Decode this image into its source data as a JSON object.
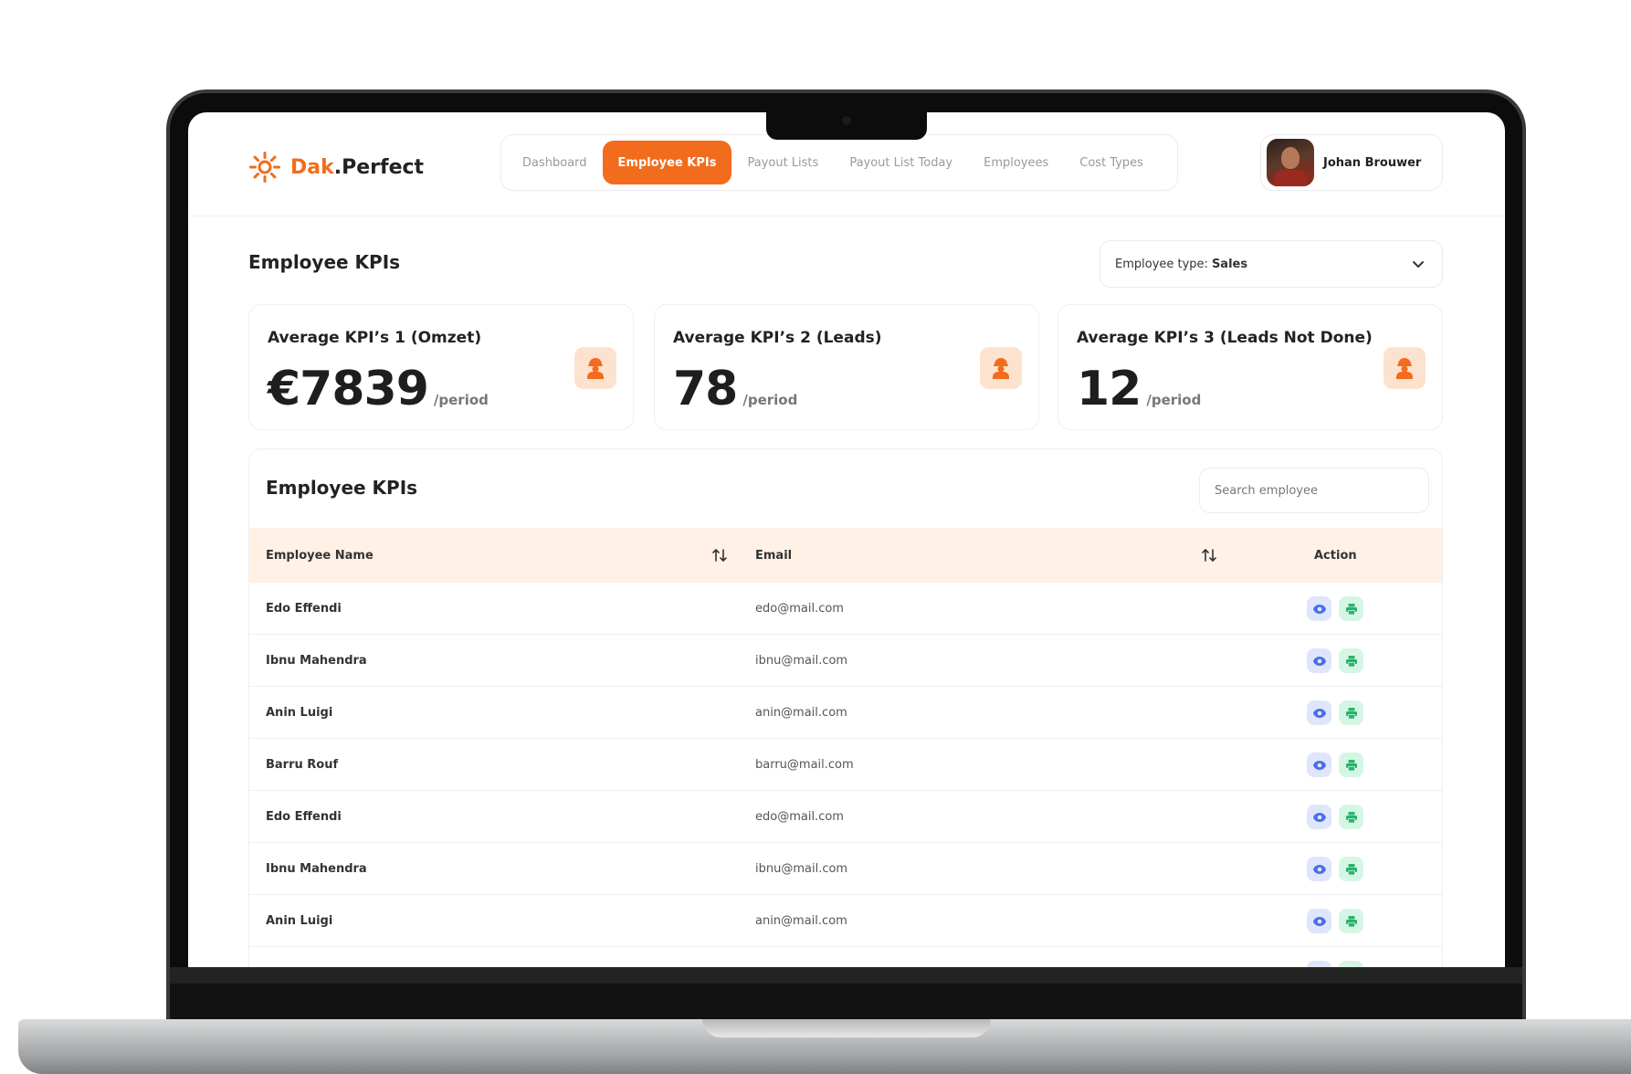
{
  "brand": {
    "name_part1": "Dak",
    "name_part2": ".Perfect",
    "accent_color": "#f26c1d"
  },
  "nav": {
    "items": [
      {
        "label": "Dashboard",
        "active": false
      },
      {
        "label": "Employee KPIs",
        "active": true
      },
      {
        "label": "Payout Lists",
        "active": false
      },
      {
        "label": "Payout List Today",
        "active": false
      },
      {
        "label": "Employees",
        "active": false
      },
      {
        "label": "Cost Types",
        "active": false
      }
    ]
  },
  "user": {
    "name": "Johan Brouwer"
  },
  "page": {
    "title": "Employee KPIs",
    "type_select": {
      "label": "Employee type:",
      "value": "Sales"
    }
  },
  "kpis": [
    {
      "title": "Average KPI’s 1 (Omzet)",
      "value": "€7839",
      "unit": "/period",
      "icon": "worker-icon"
    },
    {
      "title": "Average KPI’s 2 (Leads)",
      "value": "78",
      "unit": "/period",
      "icon": "worker-icon"
    },
    {
      "title": "Average KPI’s 3 (Leads Not Done)",
      "value": "12",
      "unit": "/period",
      "icon": "worker-icon"
    }
  ],
  "table": {
    "title": "Employee KPIs",
    "search_placeholder": "Search employee",
    "columns": {
      "name": "Employee Name",
      "email": "Email",
      "action": "Action"
    },
    "rows": [
      {
        "name": "Edo Effendi",
        "email": "edo@mail.com"
      },
      {
        "name": "Ibnu Mahendra",
        "email": "ibnu@mail.com"
      },
      {
        "name": "Anin Luigi",
        "email": "anin@mail.com"
      },
      {
        "name": "Barru Rouf",
        "email": "barru@mail.com"
      },
      {
        "name": "Edo Effendi",
        "email": "edo@mail.com"
      },
      {
        "name": "Ibnu Mahendra",
        "email": "ibnu@mail.com"
      },
      {
        "name": "Anin Luigi",
        "email": "anin@mail.com"
      }
    ],
    "action_icons": [
      "eye-icon",
      "printer-icon"
    ],
    "colors": {
      "header_bg": "#fff1e6",
      "view_bg": "#dfe6fb",
      "view_icon": "#4a6fe3",
      "print_bg": "#d6f6e5",
      "print_icon": "#27b36a"
    }
  }
}
